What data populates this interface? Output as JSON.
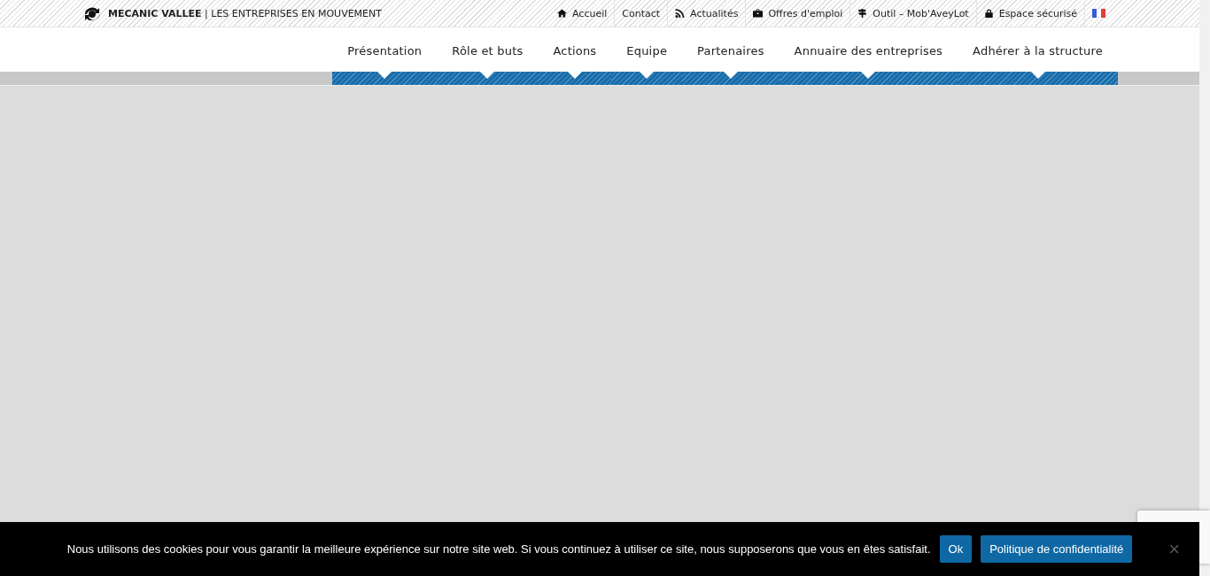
{
  "brand": "**MECANIC VALLEE** | LES ENTREPRISES EN MOUVEMENT",
  "top_links": [
    {
      "label": "Accueil",
      "kind": "home"
    },
    {
      "label": "Contact",
      "kind": "none"
    },
    {
      "label": "Actualités",
      "kind": "rss"
    },
    {
      "label": "Offres d'emploi",
      "kind": "briefcase"
    },
    {
      "label": "Outil – Mob'AveyLot",
      "kind": "signpost"
    },
    {
      "label": "Espace sécurisé",
      "kind": "lock"
    },
    {
      "kind": "flag"
    }
  ],
  "menu": [
    "Présentation",
    "Rôle et buts",
    "Actions",
    "Equipe",
    "Partenaires",
    "Annuaire des entreprises",
    "Adhérer à la structure"
  ],
  "cookie_bar": {
    "text": "Nous utilisons des cookies pour vous garantir la meilleure expérience sur notre site web. Si vous continuez à utiliser ce site, nous supposerons que vous en êtes satisfait.",
    "buttons": [
      "Ok",
      "Politique de confidentialité"
    ],
    "close": "×"
  }
}
